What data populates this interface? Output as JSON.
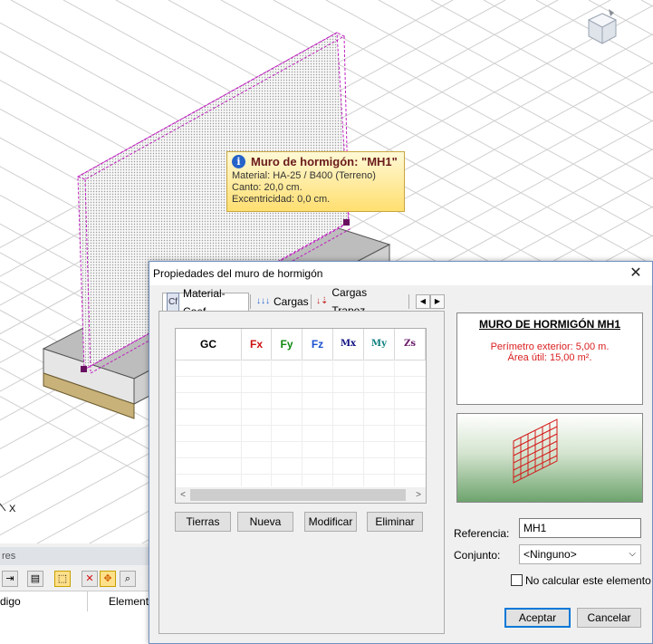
{
  "tooltip": {
    "title": "Muro de hormigón: \"MH1\"",
    "lines": [
      "Material: HA-25 / B400 (Terreno)",
      "Canto: 20,0 cm.",
      "Excentricidad: 0,0 cm."
    ]
  },
  "axis_label": "X",
  "bg_panel": {
    "title_fragment": "res",
    "col1": "digo",
    "col2": "Elemento"
  },
  "dialog": {
    "title": "Propiedades del muro de hormigón",
    "tabs": [
      {
        "icon": "Cf",
        "label": "Material-Coef."
      },
      {
        "icon": "↓↓↓",
        "label": "Cargas"
      },
      {
        "icon": "↓⇣",
        "label": "Cargas Trapez."
      }
    ],
    "grid_headers": [
      "GC",
      "Fx",
      "Fy",
      "Fz",
      "Mx",
      "My",
      "Zs"
    ],
    "buttons": {
      "tierras": "Tierras",
      "nueva": "Nueva",
      "modificar": "Modificar",
      "eliminar": "Eliminar"
    },
    "info": {
      "title": "MURO DE HORMIGÓN MH1",
      "perimeter": "Perímetro exterior: 5,00 m.",
      "area": "Área útil: 15,00 m²."
    },
    "referencia_label": "Referencia:",
    "referencia_value": "MH1",
    "conjunto_label": "Conjunto:",
    "conjunto_value": "<Ninguno>",
    "no_calcular_label": "No calcular este elemento",
    "accept": "Aceptar",
    "cancel": "Cancelar"
  },
  "colors": {
    "header_red": "#cc1111",
    "header_green": "#138a13",
    "header_blue": "#1c4fd0",
    "header_navy": "#101080",
    "header_teal": "#0f7f7f",
    "header_purple": "#6a1a6a"
  }
}
